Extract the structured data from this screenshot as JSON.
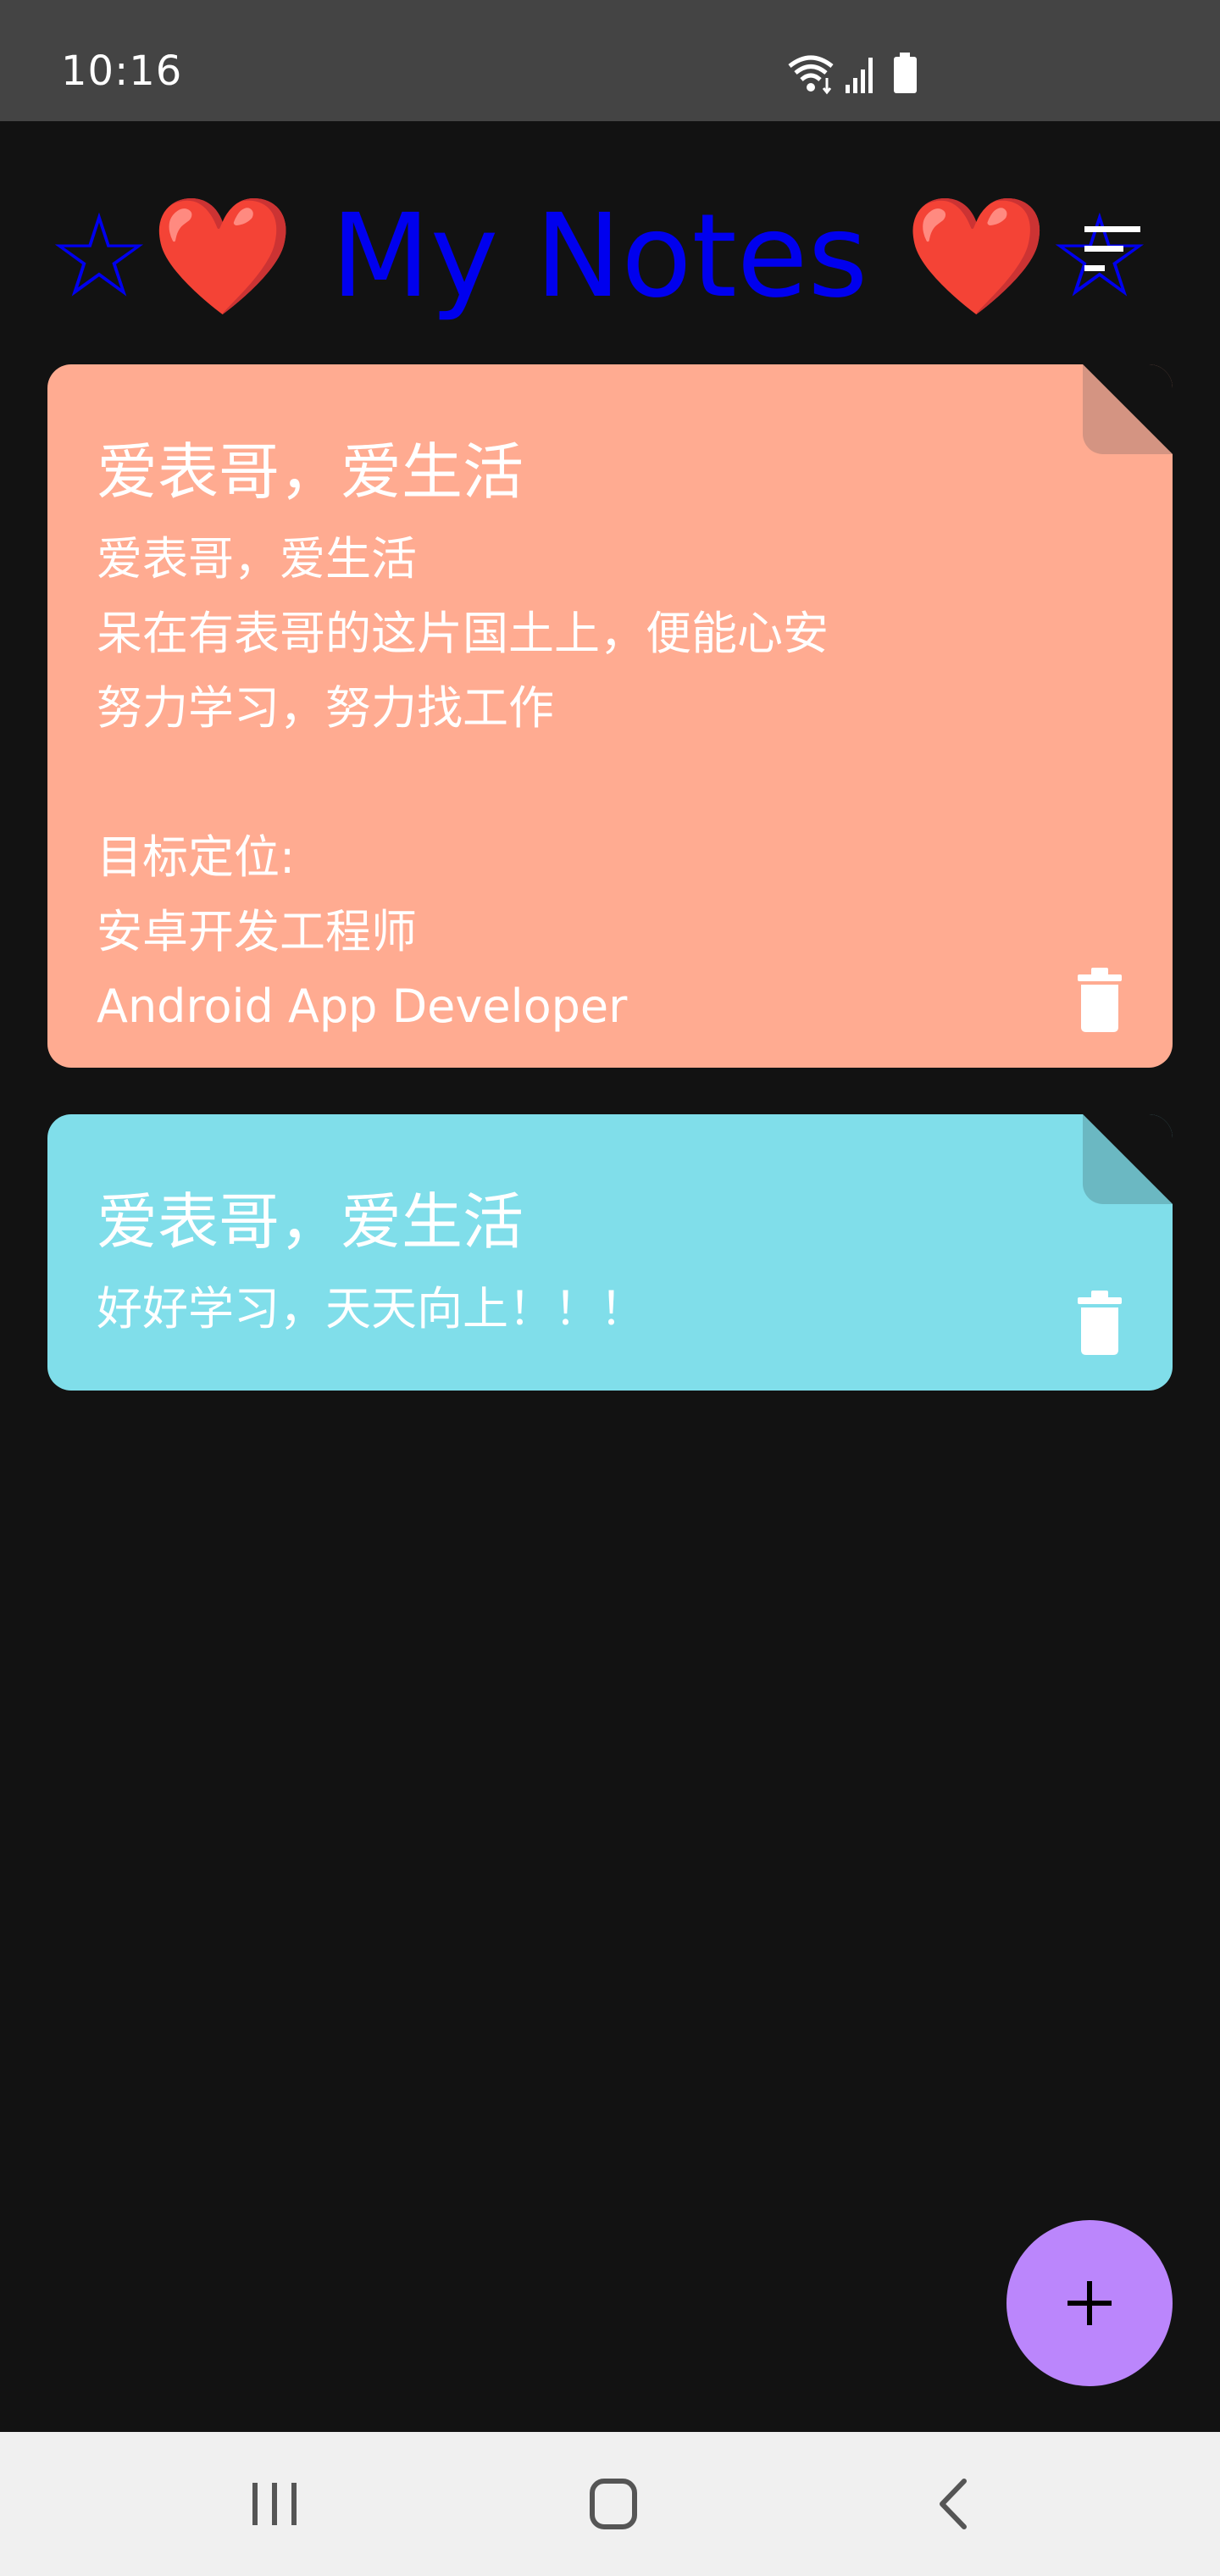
{
  "status_bar": {
    "time": "10:16",
    "icons": [
      "wifi-icon",
      "signal-icon",
      "battery-icon"
    ]
  },
  "app_bar": {
    "title": "☆❤️ My Notes ❤️☆",
    "sort_icon": "sort-icon"
  },
  "notes": [
    {
      "title": "爱表哥，爱生活",
      "body": "爱表哥，爱生活\n呆在有表哥的这片国土上，便能心安\n努力学习，努力找工作\n\n目标定位:\n安卓开发工程师\nAndroid App Developer",
      "color": "#ffab91",
      "fold_color": "#d49482"
    },
    {
      "title": "爱表哥，爱生活",
      "body": "好好学习，天天向上！！！",
      "color": "#80deea",
      "fold_color": "#6bb8c2"
    }
  ],
  "fab": {
    "icon": "plus-icon",
    "color": "#bb86fc"
  },
  "nav_bar": {
    "buttons": [
      "recent-apps-icon",
      "home-icon",
      "back-icon"
    ]
  },
  "colors": {
    "background": "#121212",
    "status_bar": "#444444",
    "title": "#0000ee"
  }
}
